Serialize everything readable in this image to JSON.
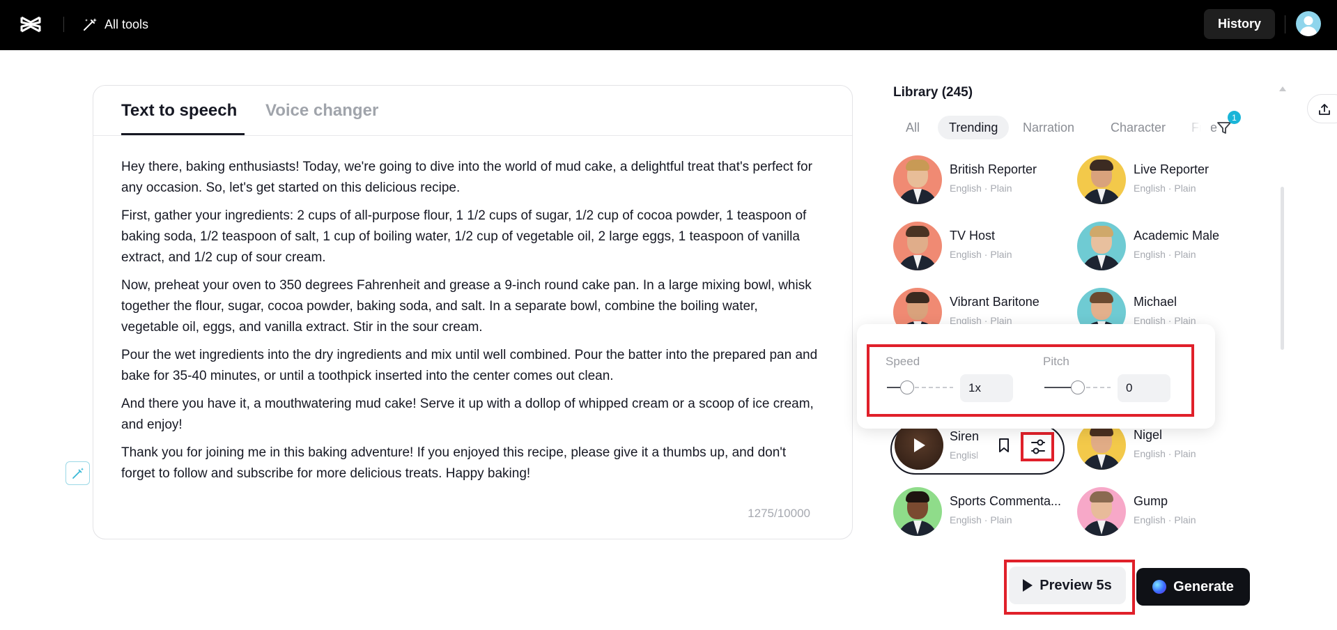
{
  "topbar": {
    "all_tools_label": "All tools",
    "history_label": "History",
    "logo_icon": "capcut-logo-icon",
    "avatar_icon": "user-avatar"
  },
  "editor": {
    "tabs": [
      {
        "label": "Text to speech",
        "active": true
      },
      {
        "label": "Voice changer",
        "active": false
      }
    ],
    "paragraphs": [
      "Hey there, baking enthusiasts! Today, we're going to dive into the world of mud cake, a delightful treat that's perfect for any occasion. So, let's get started on this delicious recipe.",
      "First, gather your ingredients: 2 cups of all-purpose flour, 1 1/2 cups of sugar, 1/2 cup of cocoa powder, 1 teaspoon of baking soda, 1/2 teaspoon of salt, 1 cup of boiling water, 1/2 cup of vegetable oil, 2 large eggs, 1 teaspoon of vanilla extract, and 1/2 cup of sour cream.",
      "Now, preheat your oven to 350 degrees Fahrenheit and grease a 9-inch round cake pan. In a large mixing bowl, whisk together the flour, sugar, cocoa powder, baking soda, and salt. In a separate bowl, combine the boiling water, vegetable oil, eggs, and vanilla extract. Stir in the sour cream.",
      "Pour the wet ingredients into the dry ingredients and mix until well combined. Pour the batter into the prepared pan and bake for 35-40 minutes, or until a toothpick inserted into the center comes out clean.",
      "And there you have it, a mouthwatering mud cake! Serve it up with a dollop of whipped cream or a scoop of ice cream, and enjoy!",
      "Thank you for joining me in this baking adventure! If you enjoyed this recipe, please give it a thumbs up, and don't forget to follow and subscribe for more delicious treats. Happy baking!"
    ],
    "char_count": "1275/10000"
  },
  "library": {
    "title": "Library (245)",
    "filter_badge": "1",
    "tabs": [
      {
        "label": "All",
        "active": false
      },
      {
        "label": "Trending",
        "active": true
      },
      {
        "label": "Narration",
        "active": false
      },
      {
        "label": "Character",
        "active": false
      },
      {
        "label": "Free",
        "active": false
      }
    ],
    "voices": [
      {
        "name": "British Reporter",
        "meta": "English · Plain",
        "bg": "#f08a73",
        "hair": "#c89a55",
        "skin": "#e8bd98"
      },
      {
        "name": "Live Reporter",
        "meta": "English · Plain",
        "bg": "#f3c94a",
        "hair": "#3c2b22",
        "skin": "#d9a27c"
      },
      {
        "name": "TV Host",
        "meta": "English · Plain",
        "bg": "#f08a73",
        "hair": "#4a3323",
        "skin": "#e0ad8a"
      },
      {
        "name": "Academic Male",
        "meta": "English · Plain",
        "bg": "#6fcbd3",
        "hair": "#cfa86a",
        "skin": "#e8c09e"
      },
      {
        "name": "Vibrant Baritone",
        "meta": "English · Plain",
        "bg": "#f08a73",
        "hair": "#3a2a20",
        "skin": "#d9a27c"
      },
      {
        "name": "Michael",
        "meta": "English · Plain",
        "bg": "#6fcbd3",
        "hair": "#6b4a30",
        "skin": "#e3b08c"
      },
      {
        "name": "Siren",
        "meta": "English · Plain",
        "bg": "#c8a48a",
        "hair": "#3d2416",
        "skin": "#e7b596"
      },
      {
        "name": "Nigel",
        "meta": "English · Plain",
        "bg": "#f3c94a",
        "hair": "#4a3020",
        "skin": "#e1ac86"
      },
      {
        "name": "Sports Commenta...",
        "meta": "English · Plain",
        "bg": "#8fdc8a",
        "hair": "#1e1410",
        "skin": "#7a4a30"
      },
      {
        "name": "Gump",
        "meta": "English · Plain",
        "bg": "#f7a8c8",
        "hair": "#8a6a50",
        "skin": "#e8bb9a"
      }
    ]
  },
  "voice_settings": {
    "speed_label": "Speed",
    "speed_value": "1x",
    "speed_level": 0.3,
    "pitch_label": "Pitch",
    "pitch_value": "0",
    "pitch_level": 0.5
  },
  "actions": {
    "preview_label": "Preview 5s",
    "generate_label": "Generate"
  },
  "colors": {
    "accent": "#19b5d8",
    "highlight": "#e0202a",
    "topbar": "#000000"
  }
}
